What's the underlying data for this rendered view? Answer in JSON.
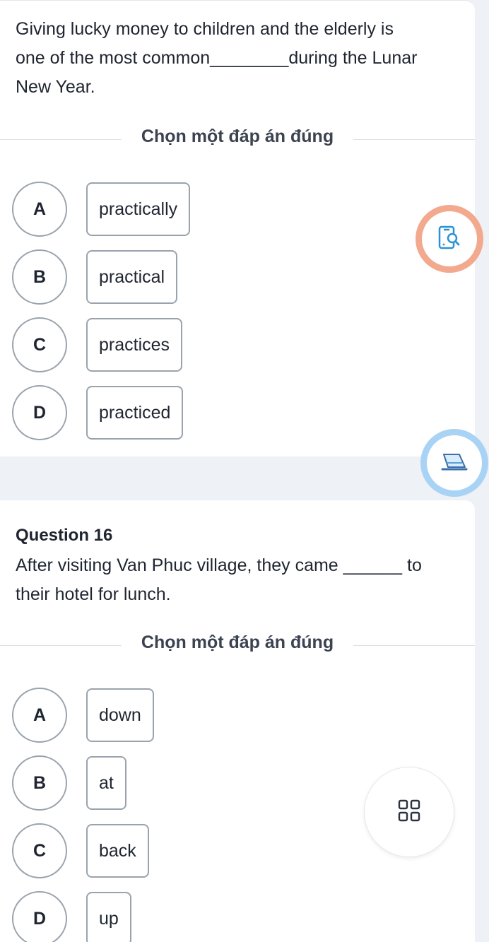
{
  "question_15": {
    "text_line1": "Giving lucky money to children and the elderly is",
    "text_line2_before": "one of the most common",
    "text_line2_blank": "________",
    "text_line2_after": "during the Lunar",
    "text_line3": "New Year.",
    "instruction": "Chọn một đáp án đúng",
    "options": [
      {
        "letter": "A",
        "text": "practically"
      },
      {
        "letter": "B",
        "text": "practical"
      },
      {
        "letter": "C",
        "text": "practices"
      },
      {
        "letter": "D",
        "text": "practiced"
      }
    ]
  },
  "question_16": {
    "title": "Question 16",
    "text_line1_before": "After visiting Van Phuc village, they came",
    "text_line1_blank": "______",
    "text_line1_after": "to",
    "text_line2": "their hotel for lunch.",
    "instruction": "Chọn một đáp án đúng",
    "options": [
      {
        "letter": "A",
        "text": "down"
      },
      {
        "letter": "B",
        "text": "at"
      },
      {
        "letter": "C",
        "text": "back"
      },
      {
        "letter": "D",
        "text": "up"
      }
    ]
  },
  "floating_buttons": {
    "search_icon": "phone-search-icon",
    "pen_icon": "pen-icon",
    "grid_icon": "grid-icon",
    "search_color": "#f3a98e",
    "pen_color": "#a9d3f5"
  }
}
